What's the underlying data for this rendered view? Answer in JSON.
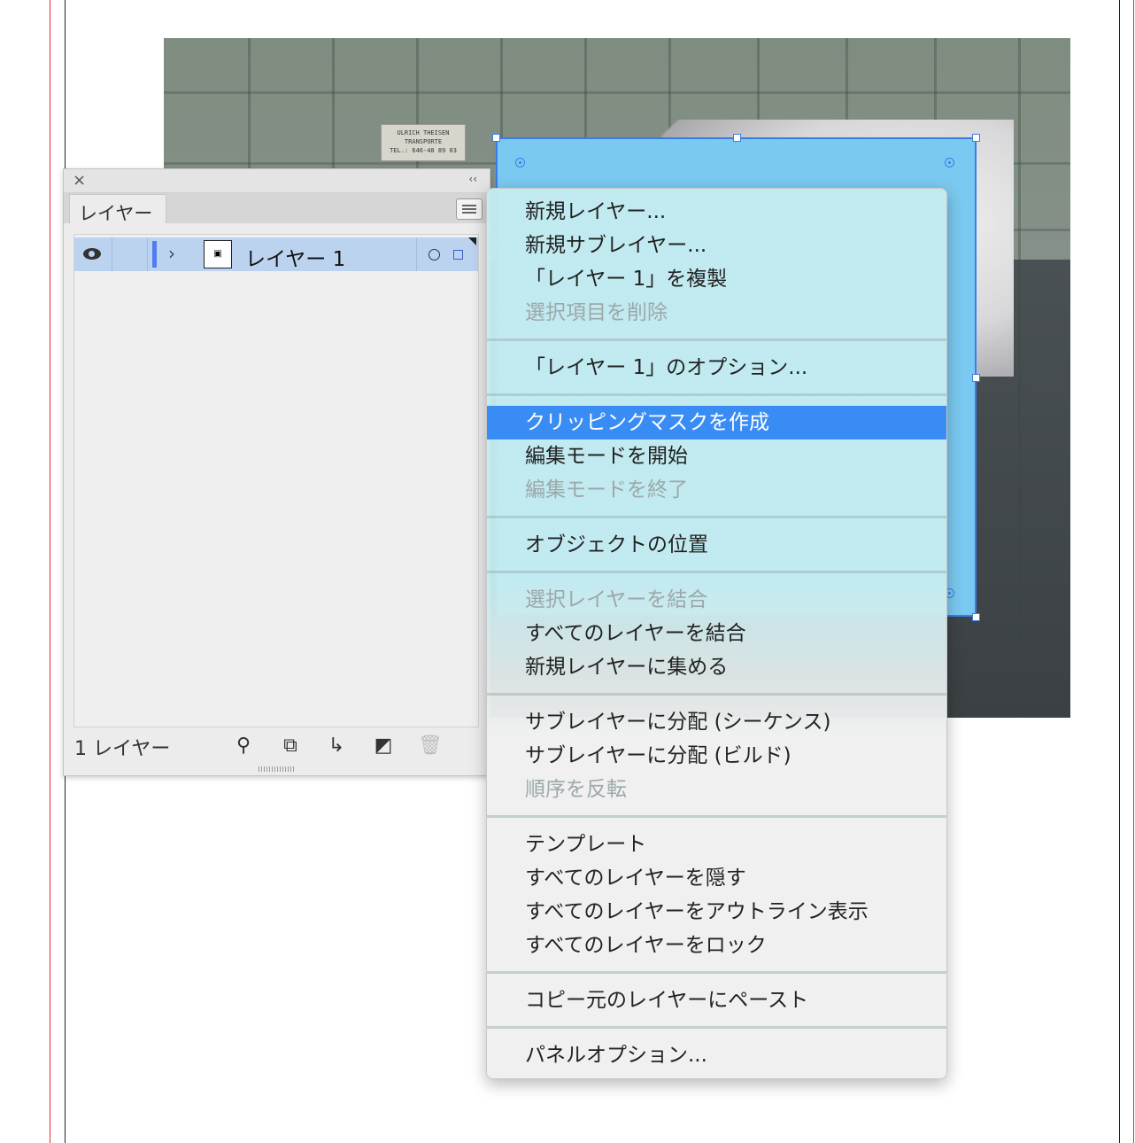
{
  "photo": {
    "sign_line1": "ULRICH THEISEN",
    "sign_line2": "TRANSPORTE",
    "sign_line3": "TEL.: 646-48 89 03"
  },
  "layers_panel": {
    "tab_label": "レイヤー",
    "close_icon": "×",
    "collapse_icon": "‹‹",
    "layer": {
      "name": "レイヤー 1",
      "expand_icon": "›"
    },
    "footer": {
      "count_label": "1 レイヤー",
      "icons": [
        "search-icon",
        "clipping-mask-icon",
        "new-sublayer-icon",
        "new-layer-icon",
        "trash-icon"
      ]
    }
  },
  "context_menu": {
    "groups": [
      [
        "新規レイヤー...",
        "新規サブレイヤー...",
        "「レイヤー 1」を複製",
        "選択項目を削除"
      ],
      [
        "「レイヤー 1」のオプション..."
      ],
      [
        "クリッピングマスクを作成",
        "編集モードを開始",
        "編集モードを終了"
      ],
      [
        "オブジェクトの位置"
      ],
      [
        "選択レイヤーを結合",
        "すべてのレイヤーを結合",
        "新規レイヤーに集める"
      ],
      [
        "サブレイヤーに分配 (シーケンス)",
        "サブレイヤーに分配 (ビルド)",
        "順序を反転"
      ],
      [
        "テンプレート",
        "すべてのレイヤーを隠す",
        "すべてのレイヤーをアウトライン表示",
        "すべてのレイヤーをロック"
      ],
      [
        "コピー元のレイヤーにペースト"
      ],
      [
        "パネルオプション..."
      ]
    ],
    "highlighted": "クリッピングマスクを作成",
    "disabled": [
      "選択項目を削除",
      "編集モードを終了",
      "選択レイヤーを結合",
      "順序を反転"
    ]
  },
  "colors": {
    "selection_fill": "#7ac9f0",
    "selection_stroke": "#3c7ce8",
    "menu_highlight": "#3a8cf5",
    "layer_row_bg": "#bcd3f0",
    "layer_color_bar": "#4f7cf0"
  }
}
